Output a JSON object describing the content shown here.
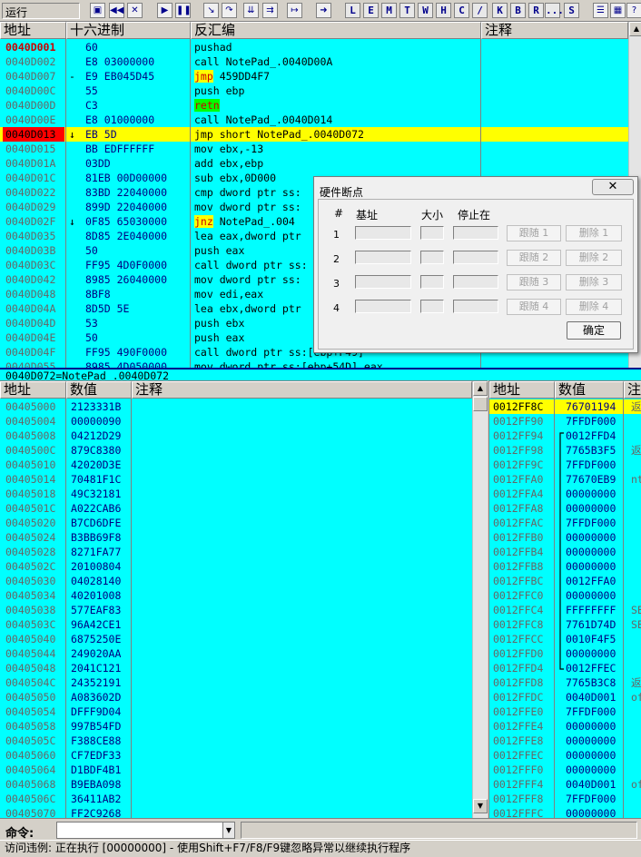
{
  "toolbar": {
    "run_status": "运行",
    "icon_buttons": [
      "open-icon",
      "rewind-icon",
      "close-icon",
      "play-icon",
      "pause-icon",
      "step-into-icon",
      "step-over-icon",
      "trace-into-icon",
      "trace-over-icon",
      "exec-till-return-icon",
      "goto-icon"
    ],
    "letter_buttons": [
      "L",
      "E",
      "M",
      "T",
      "W",
      "H",
      "C",
      "/",
      "K",
      "B",
      "R",
      "...",
      "S"
    ],
    "right_icons": [
      "list-icon",
      "grid-icon",
      "help-icon"
    ]
  },
  "cpu": {
    "headers": {
      "addr": "地址",
      "hex": "十六进制",
      "disasm": "反汇编",
      "comment": "注释"
    },
    "rows": [
      {
        "addr": "0040D001",
        "hex": "60",
        "disasm": "pushad",
        "mark": "",
        "style": "bp"
      },
      {
        "addr": "0040D002",
        "hex": "E8 03000000",
        "disasm": "call NotePad_.0040D00A",
        "mark": "",
        "style": ""
      },
      {
        "addr": "0040D007",
        "hex": "E9 EB045D45",
        "disasm": "jmp 459DD4F7",
        "mark": "-",
        "style": "jmp"
      },
      {
        "addr": "0040D00C",
        "hex": "55",
        "disasm": "push ebp",
        "mark": "",
        "style": ""
      },
      {
        "addr": "0040D00D",
        "hex": "C3",
        "disasm": "retn",
        "mark": "",
        "style": "ret"
      },
      {
        "addr": "0040D00E",
        "hex": "E8 01000000",
        "disasm": "call NotePad_.0040D014",
        "mark": "",
        "style": ""
      },
      {
        "addr": "0040D013",
        "hex": "EB 5D",
        "disasm": "jmp short NotePad_.0040D072",
        "mark": "↓",
        "style": "current"
      },
      {
        "addr": "0040D015",
        "hex": "BB EDFFFFFF",
        "disasm": "mov ebx,-13",
        "mark": "",
        "style": ""
      },
      {
        "addr": "0040D01A",
        "hex": "03DD",
        "disasm": "add ebx,ebp",
        "mark": "",
        "style": ""
      },
      {
        "addr": "0040D01C",
        "hex": "81EB 00D00000",
        "disasm": "sub ebx,0D000",
        "mark": "",
        "style": ""
      },
      {
        "addr": "0040D022",
        "hex": "83BD 22040000",
        "disasm": "cmp dword ptr ss:",
        "mark": "",
        "style": ""
      },
      {
        "addr": "0040D029",
        "hex": "899D 22040000",
        "disasm": "mov dword ptr ss:",
        "mark": "",
        "style": ""
      },
      {
        "addr": "0040D02F",
        "hex": "0F85 65030000",
        "disasm": "jnz NotePad_.004",
        "mark": "↓",
        "style": "jmp"
      },
      {
        "addr": "0040D035",
        "hex": "8D85 2E040000",
        "disasm": "lea eax,dword ptr",
        "mark": "",
        "style": ""
      },
      {
        "addr": "0040D03B",
        "hex": "50",
        "disasm": "push eax",
        "mark": "",
        "style": ""
      },
      {
        "addr": "0040D03C",
        "hex": "FF95 4D0F0000",
        "disasm": "call dword ptr ss:",
        "mark": "",
        "style": ""
      },
      {
        "addr": "0040D042",
        "hex": "8985 26040000",
        "disasm": "mov dword ptr ss:",
        "mark": "",
        "style": ""
      },
      {
        "addr": "0040D048",
        "hex": "8BF8",
        "disasm": "mov edi,eax",
        "mark": "",
        "style": ""
      },
      {
        "addr": "0040D04A",
        "hex": "8D5D 5E",
        "disasm": "lea ebx,dword ptr",
        "mark": "",
        "style": ""
      },
      {
        "addr": "0040D04D",
        "hex": "53",
        "disasm": "push ebx",
        "mark": "",
        "style": ""
      },
      {
        "addr": "0040D04E",
        "hex": "50",
        "disasm": "push eax",
        "mark": "",
        "style": ""
      },
      {
        "addr": "0040D04F",
        "hex": "FF95 490F0000",
        "disasm": "call dword ptr ss:[ebp+F49]",
        "mark": "",
        "style": ""
      },
      {
        "addr": "0040D055",
        "hex": "8985 4D050000",
        "disasm": "mov dword ptr ss:[ebp+54D],eax",
        "mark": "",
        "style": ""
      }
    ]
  },
  "info_line": "0040D072=NotePad_.0040D072",
  "dump": {
    "headers": {
      "addr": "地址",
      "value": "数值",
      "comment": "注释"
    },
    "rows": [
      [
        "00405000",
        "2123331B"
      ],
      [
        "00405004",
        "00000090"
      ],
      [
        "00405008",
        "04212D29"
      ],
      [
        "0040500C",
        "879C8380"
      ],
      [
        "00405010",
        "42020D3E"
      ],
      [
        "00405014",
        "70481F1C"
      ],
      [
        "00405018",
        "49C32181"
      ],
      [
        "0040501C",
        "A022CAB6"
      ],
      [
        "00405020",
        "B7CD6DFE"
      ],
      [
        "00405024",
        "B3BB69F8"
      ],
      [
        "00405028",
        "8271FA77"
      ],
      [
        "0040502C",
        "20100804"
      ],
      [
        "00405030",
        "04028140"
      ],
      [
        "00405034",
        "40201008"
      ],
      [
        "00405038",
        "577EAF83"
      ],
      [
        "0040503C",
        "96A42CE1"
      ],
      [
        "00405040",
        "6875250E"
      ],
      [
        "00405044",
        "249020AA"
      ],
      [
        "00405048",
        "2041C121"
      ],
      [
        "0040504C",
        "24352191"
      ],
      [
        "00405050",
        "A083602D"
      ],
      [
        "00405054",
        "DFFF9D04"
      ],
      [
        "00405058",
        "997B54FD"
      ],
      [
        "0040505C",
        "F388CE88"
      ],
      [
        "00405060",
        "CF7EDF33"
      ],
      [
        "00405064",
        "D1BDF4B1"
      ],
      [
        "00405068",
        "B9EBA098"
      ],
      [
        "0040506C",
        "36411AB2"
      ],
      [
        "00405070",
        "FF2C9268"
      ]
    ]
  },
  "stack": {
    "headers": {
      "addr": "地址",
      "value": "数值",
      "comment": "注"
    },
    "rows": [
      [
        "0012FF8C",
        "76701194",
        "返"
      ],
      [
        "0012FF90",
        "7FFDF000",
        ""
      ],
      [
        "0012FF94",
        "0012FFD4",
        ""
      ],
      [
        "0012FF98",
        "7765B3F5",
        "返"
      ],
      [
        "0012FF9C",
        "7FFDF000",
        ""
      ],
      [
        "0012FFA0",
        "77670EB9",
        "nt"
      ],
      [
        "0012FFA4",
        "00000000",
        ""
      ],
      [
        "0012FFA8",
        "00000000",
        ""
      ],
      [
        "0012FFAC",
        "7FFDF000",
        ""
      ],
      [
        "0012FFB0",
        "00000000",
        ""
      ],
      [
        "0012FFB4",
        "00000000",
        ""
      ],
      [
        "0012FFB8",
        "00000000",
        ""
      ],
      [
        "0012FFBC",
        "0012FFA0",
        ""
      ],
      [
        "0012FFC0",
        "00000000",
        ""
      ],
      [
        "0012FFC4",
        "FFFFFFFF",
        "SE"
      ],
      [
        "0012FFC8",
        "7761D74D",
        "SE"
      ],
      [
        "0012FFCC",
        "0010F4F5",
        ""
      ],
      [
        "0012FFD0",
        "00000000",
        ""
      ],
      [
        "0012FFD4",
        "0012FFEC",
        ""
      ],
      [
        "0012FFD8",
        "7765B3C8",
        "返"
      ],
      [
        "0012FFDC",
        "0040D001",
        "of"
      ],
      [
        "0012FFE0",
        "7FFDF000",
        ""
      ],
      [
        "0012FFE4",
        "00000000",
        ""
      ],
      [
        "0012FFE8",
        "00000000",
        ""
      ],
      [
        "0012FFEC",
        "00000000",
        ""
      ],
      [
        "0012FFF0",
        "00000000",
        ""
      ],
      [
        "0012FFF4",
        "0040D001",
        "of"
      ],
      [
        "0012FFF8",
        "7FFDF000",
        ""
      ],
      [
        "0012FFFC",
        "00000000",
        ""
      ]
    ]
  },
  "dialog": {
    "title": "硬件断点",
    "close": "✕",
    "col_num": "#",
    "col_base": "基址",
    "col_size": "大小",
    "col_stop": "停止在",
    "rows": [
      {
        "n": "1",
        "follow": "跟随 1",
        "del": "删除 1"
      },
      {
        "n": "2",
        "follow": "跟随 2",
        "del": "删除 2"
      },
      {
        "n": "3",
        "follow": "跟随 3",
        "del": "删除 3"
      },
      {
        "n": "4",
        "follow": "跟随 4",
        "del": "删除 4"
      }
    ],
    "ok": "确定"
  },
  "command": {
    "label": "命令:",
    "value": ""
  },
  "status": "访问违例: 正在执行 [00000000] - 使用Shift+F7/F8/F9键忽略异常以继续执行程序"
}
